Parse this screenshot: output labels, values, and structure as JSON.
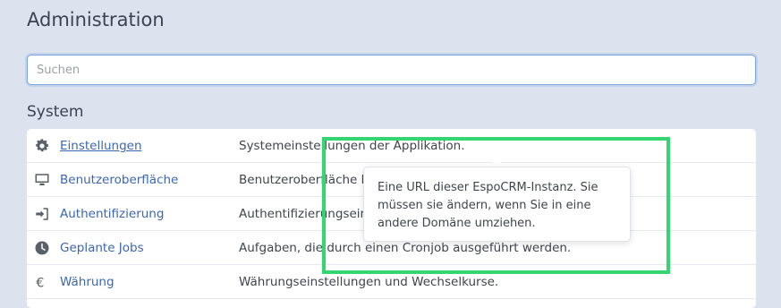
{
  "header": {
    "title": "Administration"
  },
  "search": {
    "placeholder": "Suchen"
  },
  "section": {
    "title": "System"
  },
  "rows": [
    {
      "icon": "gear-icon",
      "label": "Einstellungen",
      "description": "Systemeinstellungen der Applikation."
    },
    {
      "icon": "monitor-icon",
      "label": "Benutzeroberfläche",
      "description": "Benutzeroberfläche k"
    },
    {
      "icon": "sign-in-icon",
      "label": "Authentifizierung",
      "description": "Authentifizierungsein"
    },
    {
      "icon": "clock-icon",
      "label": "Geplante Jobs",
      "description": "Aufgaben, die durch einen Cronjob ausgeführt werden."
    },
    {
      "icon": "euro-icon",
      "label": "Währung",
      "description": "Währungseinstellungen und Wechselkurse."
    }
  ],
  "tooltip": {
    "text": "Eine URL dieser EspoCRM-Instanz. Sie müssen sie ändern, wenn Sie in eine andere Domäne umziehen."
  },
  "colors": {
    "background": "#dde2ef",
    "link": "#3b66b2",
    "highlight": "#35d672",
    "focus_border": "#7aa6de"
  }
}
